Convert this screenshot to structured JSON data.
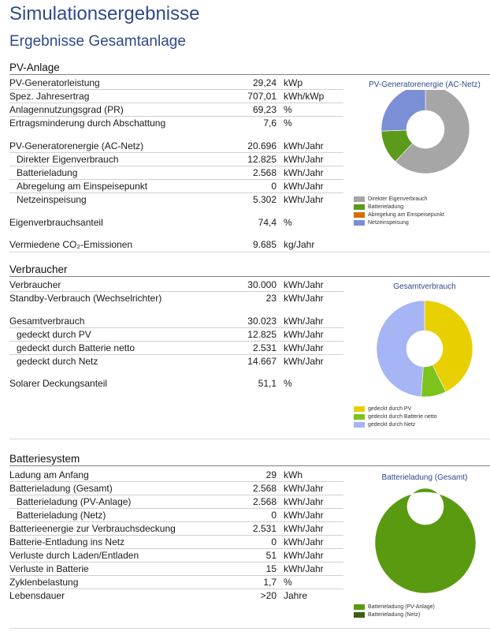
{
  "page": {
    "title": "Simulationsergebnisse",
    "subtitle": "Ergebnisse Gesamtanlage"
  },
  "pv": {
    "heading": "PV-Anlage",
    "rows": [
      {
        "label": "PV-Generatorleistung",
        "value": "29,24",
        "unit": "kWp"
      },
      {
        "label": "Spez. Jahresertrag",
        "value": "707,01",
        "unit": "kWh/kWp"
      },
      {
        "label": "Anlagennutzungsgrad (PR)",
        "value": "69,23",
        "unit": "%"
      },
      {
        "label": "Ertragsminderung durch Abschattung",
        "value": "7,6",
        "unit": "%"
      },
      {
        "label": "PV-Generatorenergie (AC-Netz)",
        "value": "20.696",
        "unit": "kWh/Jahr"
      },
      {
        "label": "Direkter Eigenverbrauch",
        "value": "12.825",
        "unit": "kWh/Jahr"
      },
      {
        "label": "Batterieladung",
        "value": "2.568",
        "unit": "kWh/Jahr"
      },
      {
        "label": "Abregelung am Einspeisepunkt",
        "value": "0",
        "unit": "kWh/Jahr"
      },
      {
        "label": "Netzeinspeisung",
        "value": "5.302",
        "unit": "kWh/Jahr"
      },
      {
        "label": "Eigenverbrauchsanteil",
        "value": "74,4",
        "unit": "%"
      },
      {
        "label": "Vermiedene CO₂-Emissionen",
        "value": "9.685",
        "unit": "kg/Jahr"
      }
    ],
    "chart": {
      "title": "PV-Generatorenergie (AC-Netz)",
      "legend": [
        "Direkter Eigenverbrauch",
        "Batterieladung",
        "Abregelung am Einspeisepunkt",
        "Netzeinspeisung"
      ]
    }
  },
  "verbraucher": {
    "heading": "Verbraucher",
    "rows": [
      {
        "label": "Verbraucher",
        "value": "30.000",
        "unit": "kWh/Jahr"
      },
      {
        "label": "Standby-Verbrauch (Wechselrichter)",
        "value": "23",
        "unit": "kWh/Jahr"
      },
      {
        "label": "Gesamtverbrauch",
        "value": "30.023",
        "unit": "kWh/Jahr"
      },
      {
        "label": "gedeckt durch PV",
        "value": "12.825",
        "unit": "kWh/Jahr"
      },
      {
        "label": "gedeckt durch Batterie netto",
        "value": "2.531",
        "unit": "kWh/Jahr"
      },
      {
        "label": "gedeckt durch Netz",
        "value": "14.667",
        "unit": "kWh/Jahr"
      },
      {
        "label": "Solarer Deckungsanteil",
        "value": "51,1",
        "unit": "%"
      }
    ],
    "chart": {
      "title": "Gesamtverbrauch",
      "legend": [
        "gedeckt durch PV",
        "gedeckt durch Batterie netto",
        "gedeckt durch Netz"
      ]
    }
  },
  "batterie": {
    "heading": "Batteriesystem",
    "rows": [
      {
        "label": "Ladung am Anfang",
        "value": "29",
        "unit": "kWh"
      },
      {
        "label": "Batterieladung (Gesamt)",
        "value": "2.568",
        "unit": "kWh/Jahr"
      },
      {
        "label": "Batterieladung (PV-Anlage)",
        "value": "2.568",
        "unit": "kWh/Jahr"
      },
      {
        "label": "Batterieladung (Netz)",
        "value": "0",
        "unit": "kWh/Jahr"
      },
      {
        "label": "Batterieenergie zur Verbrauchsdeckung",
        "value": "2.531",
        "unit": "kWh/Jahr"
      },
      {
        "label": "Batterie-Entladung ins Netz",
        "value": "0",
        "unit": "kWh/Jahr"
      },
      {
        "label": "Verluste durch Laden/Entladen",
        "value": "51",
        "unit": "kWh/Jahr"
      },
      {
        "label": "Verluste in Batterie",
        "value": "15",
        "unit": "kWh/Jahr"
      },
      {
        "label": "Zyklenbelastung",
        "value": "1,7",
        "unit": "%"
      },
      {
        "label": "Lebensdauer",
        "value": ">20",
        "unit": "Jahre"
      }
    ],
    "chart": {
      "title": "Batterieladung (Gesamt)",
      "legend": [
        "Batterieladung (PV-Anlage)",
        "Batterieladung (Netz)"
      ]
    }
  },
  "colors": {
    "title": "#2f4a8a",
    "grey": "#a6a6a6",
    "green": "#5b9a1a",
    "orange": "#d96c00",
    "blue": "#7b8fd6",
    "yellow": "#e8d000",
    "lightgreen": "#7cc31c",
    "lightblue": "#a5b5f5",
    "olive": "#5a9a10",
    "darkolive": "#3d5f12"
  },
  "chart_data": [
    {
      "type": "pie",
      "title": "PV-Generatorenergie (AC-Netz)",
      "categories": [
        "Direkter Eigenverbrauch",
        "Batterieladung",
        "Abregelung am Einspeisepunkt",
        "Netzeinspeisung"
      ],
      "values": [
        12825,
        2568,
        0,
        5302
      ],
      "colors": [
        "#a6a6a6",
        "#5b9a1a",
        "#d96c00",
        "#7b8fd6"
      ],
      "legend": "bottom-left"
    },
    {
      "type": "pie",
      "title": "Gesamtverbrauch",
      "categories": [
        "gedeckt durch PV",
        "gedeckt durch Batterie netto",
        "gedeckt durch Netz"
      ],
      "values": [
        12825,
        2531,
        14667
      ],
      "colors": [
        "#e8d000",
        "#7cc31c",
        "#a5b5f5"
      ],
      "legend": "bottom-left"
    },
    {
      "type": "pie",
      "title": "Batterieladung (Gesamt)",
      "categories": [
        "Batterieladung (PV-Anlage)",
        "Batterieladung (Netz)"
      ],
      "values": [
        2568,
        0
      ],
      "colors": [
        "#5a9a10",
        "#3d5f12"
      ],
      "legend": "bottom-left"
    }
  ]
}
